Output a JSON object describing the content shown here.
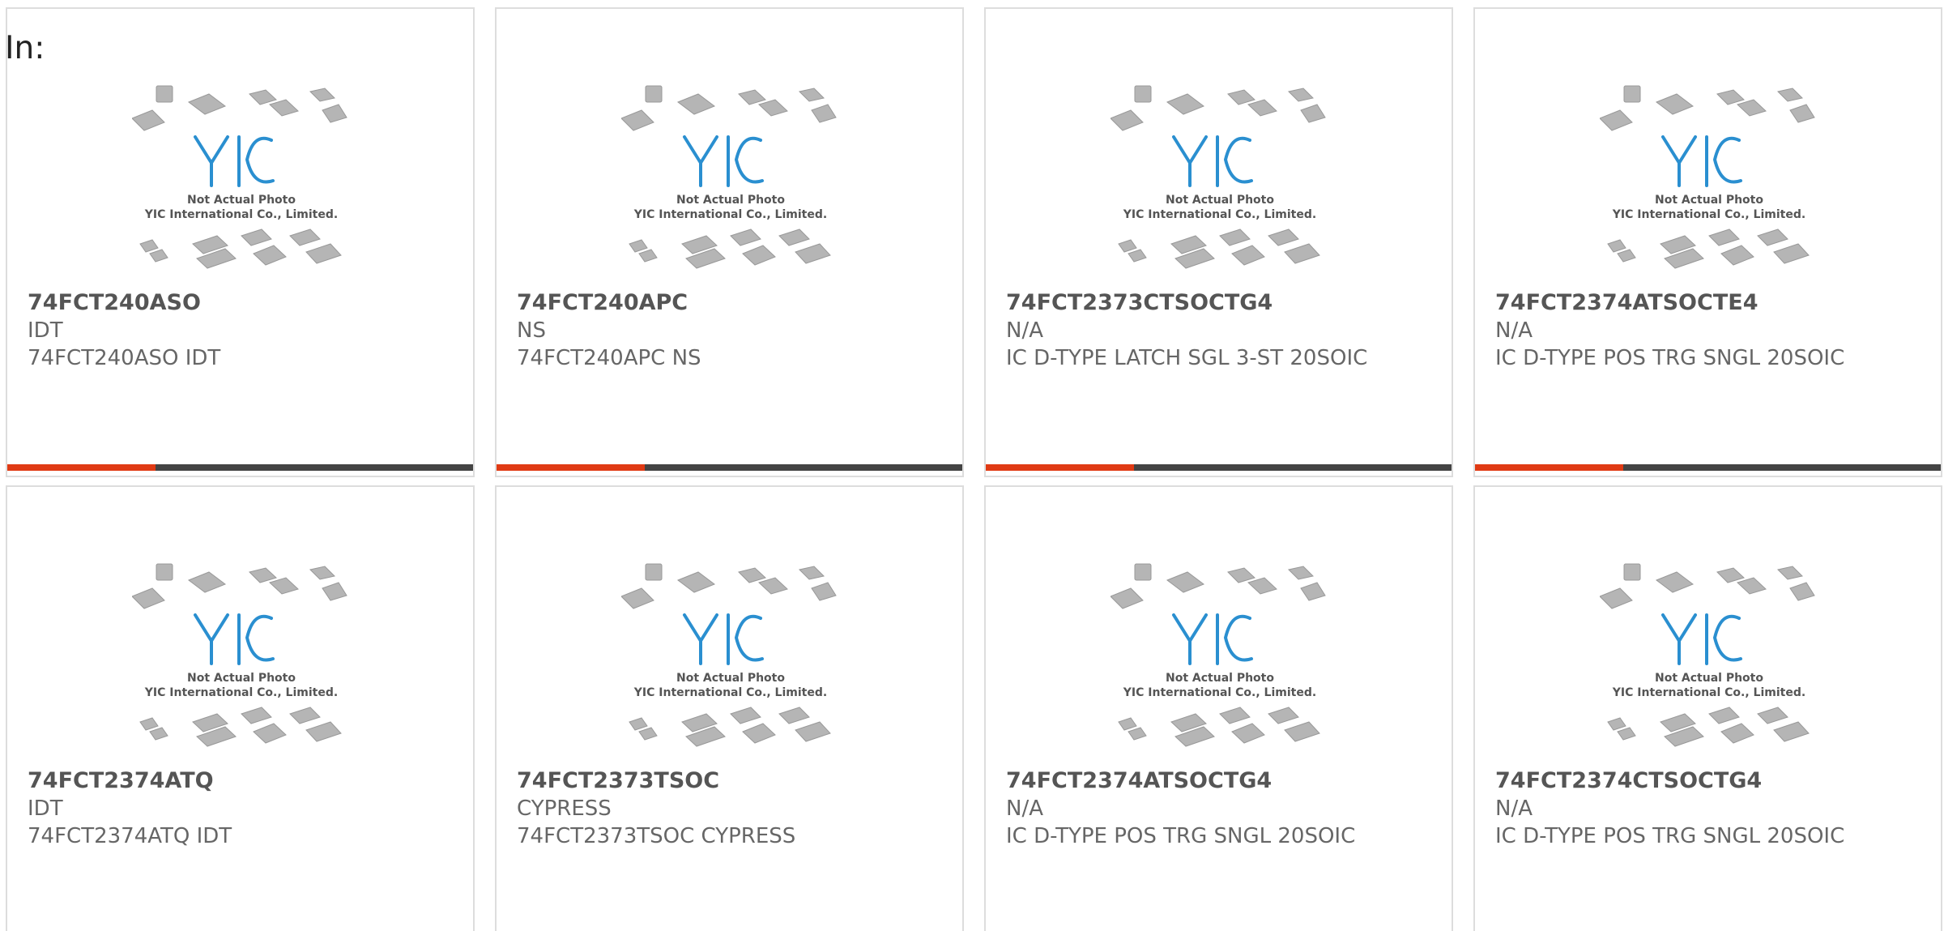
{
  "header": {
    "label": "In:"
  },
  "photo": {
    "logo_text": "YIC",
    "caption_line1": "Not Actual Photo",
    "caption_line2": "YIC International Co., Limited."
  },
  "colors": {
    "accent": "#e03a14",
    "bar": "#444444",
    "border": "#dddddd",
    "logo": "#2a8fd0"
  },
  "products": [
    {
      "part": "74FCT240ASO",
      "manufacturer": "IDT",
      "description": "74FCT240ASO IDT"
    },
    {
      "part": "74FCT240APC",
      "manufacturer": "NS",
      "description": "74FCT240APC NS"
    },
    {
      "part": "74FCT2373CTSOCTG4",
      "manufacturer": "N/A",
      "description": "IC D-TYPE LATCH SGL 3-ST 20SOIC"
    },
    {
      "part": "74FCT2374ATSOCTE4",
      "manufacturer": "N/A",
      "description": "IC D-TYPE POS TRG SNGL 20SOIC"
    },
    {
      "part": "74FCT2374ATQ",
      "manufacturer": "IDT",
      "description": "74FCT2374ATQ IDT"
    },
    {
      "part": "74FCT2373TSOC",
      "manufacturer": "CYPRESS",
      "description": "74FCT2373TSOC CYPRESS"
    },
    {
      "part": "74FCT2374ATSOCTG4",
      "manufacturer": "N/A",
      "description": "IC D-TYPE POS TRG SNGL 20SOIC"
    },
    {
      "part": "74FCT2374CTSOCTG4",
      "manufacturer": "N/A",
      "description": "IC D-TYPE POS TRG SNGL 20SOIC"
    }
  ]
}
